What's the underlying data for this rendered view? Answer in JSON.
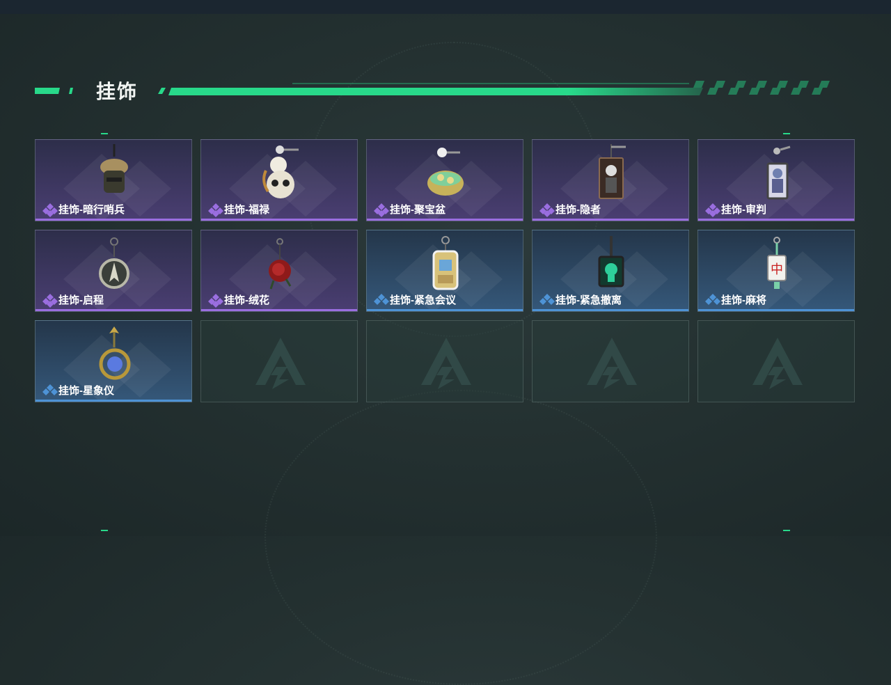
{
  "header": {
    "title": "挂饰"
  },
  "colors": {
    "accent": "#28d98a",
    "purple_rarity": "#9a6ee0",
    "blue_rarity": "#4e93d6"
  },
  "items": [
    {
      "name": "挂饰-暗行哨兵",
      "rarity": "purple",
      "icon": "sentinel-charm"
    },
    {
      "name": "挂饰-福禄",
      "rarity": "purple",
      "icon": "gourd-panda-charm"
    },
    {
      "name": "挂饰-聚宝盆",
      "rarity": "purple",
      "icon": "treasure-bowl-charm"
    },
    {
      "name": "挂饰-隐者",
      "rarity": "purple",
      "icon": "hermit-card-charm"
    },
    {
      "name": "挂饰-审判",
      "rarity": "purple",
      "icon": "judgement-card-charm"
    },
    {
      "name": "挂饰-启程",
      "rarity": "purple",
      "icon": "compass-charm"
    },
    {
      "name": "挂饰-绒花",
      "rarity": "purple",
      "icon": "rose-charm"
    },
    {
      "name": "挂饰-紧急会议",
      "rarity": "blue",
      "icon": "meeting-charm"
    },
    {
      "name": "挂饰-紧急撤离",
      "rarity": "blue",
      "icon": "evacuation-charm"
    },
    {
      "name": "挂饰-麻将",
      "rarity": "blue",
      "icon": "mahjong-charm"
    },
    {
      "name": "挂饰-星象仪",
      "rarity": "blue",
      "icon": "astrolabe-charm"
    }
  ],
  "empty_slots": 4,
  "mahjong_tile_char": "中"
}
